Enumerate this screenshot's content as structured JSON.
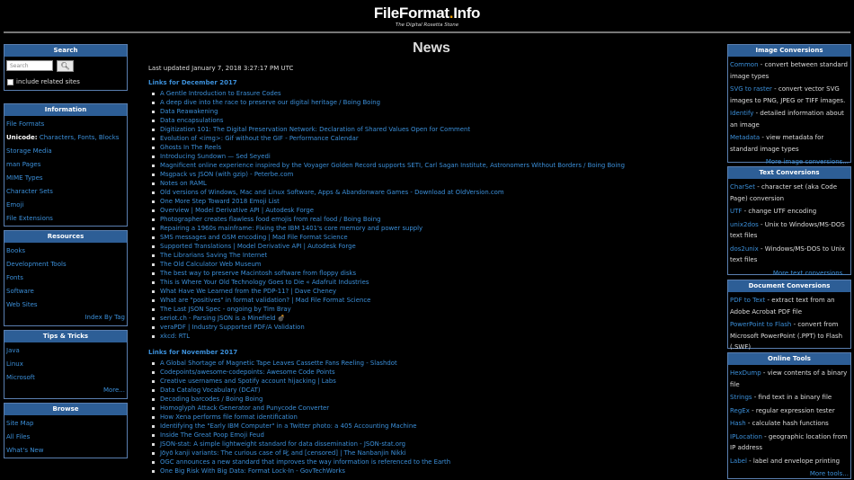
{
  "site": {
    "title_main": "FileFormat",
    "title_dot": ".",
    "title_tld": "Info",
    "tagline": "The Digital Rosetta Stone"
  },
  "search": {
    "title": "Search",
    "placeholder": "Search",
    "include_label": "include related sites"
  },
  "information": {
    "title": "Information",
    "items": [
      "File Formats"
    ],
    "unicode_label": "Unicode:",
    "unicode_links": [
      "Characters",
      "Fonts",
      "Blocks"
    ],
    "items2": [
      "Storage Media",
      "man Pages",
      "MIME Types",
      "Character Sets",
      "Emoji",
      "File Extensions"
    ]
  },
  "resources": {
    "title": "Resources",
    "items": [
      "Books",
      "Development Tools",
      "Fonts",
      "Software",
      "Web Sites"
    ],
    "more": "Index By Tag"
  },
  "tips": {
    "title": "Tips & Tricks",
    "items": [
      "Java",
      "Linux",
      "Microsoft"
    ],
    "more": "More..."
  },
  "browse": {
    "title": "Browse",
    "items": [
      "Site Map",
      "All Files",
      "What's New"
    ]
  },
  "main": {
    "heading": "News",
    "updated": "Last updated January 7, 2018 3:27:17 PM UTC",
    "sections": [
      {
        "title": "Links for December 2017",
        "links": [
          "A Gentle Introduction to Erasure Codes",
          "A deep dive into the race to preserve our digital heritage / Boing Boing",
          "Data Reawakening",
          "Data encapsulations",
          "Digitization 101: The Digital Preservation Network: Declaration of Shared Values Open for Comment",
          "Evolution of <img>: Gif without the GIF - Performance Calendar",
          "Ghosts In The Reels",
          "Introducing Sundown — Sed Seyedi",
          "Magnificent online experience inspired by the Voyager Golden Record supports SETI, Carl Sagan Institute, Astronomers Without Borders / Boing Boing",
          "Msgpack vs JSON (with gzip) - Peterbe.com",
          "Notes on RAML",
          "Old versions of Windows, Mac and Linux Software, Apps & Abandonware Games - Download at OldVersion.com",
          "One More Step Toward 2018 Emoji List",
          "Overview | Model Derivative API | Autodesk Forge",
          "Photographer creates flawless food emojis from real food / Boing Boing",
          "Repairing a 1960s mainframe: Fixing the IBM 1401's core memory and power supply",
          "SMS messages and GSM encoding | Mad File Format Science",
          "Supported Translations | Model Derivative API | Autodesk Forge",
          "The Librarians Saving The Internet",
          "The Old Calculator Web Museum",
          "The best way to preserve Macintosh software from floppy disks",
          "This is Where Your Old Technology Goes to Die « Adafruit Industries",
          "What Have We Learned from the PDP-11? | Dave Cheney",
          "What are \"positives\" in format validation? | Mad File Format Science",
          "The Last JSON Spec - ongoing by Tim Bray",
          "seriot.ch - Parsing JSON is a Minefield 💣",
          "veraPDF | Industry Supported PDF/A Validation",
          "xkcd: RTL"
        ]
      },
      {
        "title": "Links for November 2017",
        "links": [
          "A Global Shortage of Magnetic Tape Leaves Cassette Fans Reeling - Slashdot",
          "Codepoints/awesome-codepoints: Awesome Code Points",
          "Creative usernames and Spotify account hijacking | Labs",
          "Data Catalog Vocabulary (DCAT)",
          "Decoding barcodes / Boing Boing",
          "Homoglyph Attack Generator and Punycode Converter",
          "How Xena performs file format identification",
          "Identifying the \"Early IBM Computer\" in a Twitter photo: a 405 Accounting Machine",
          "Inside The Great Poop Emoji Feud",
          "JSON-stat: A simple lightweight standard for data dissemination - JSON-stat.org",
          "Jōyō kanji variants: The curious case of 叱 and [censored] | The Nanbanjin Nikki",
          "OGC announces a new standard that improves the way information is referenced to the Earth",
          "One Big Risk With Big Data: Format Lock-In - GovTechWorks"
        ]
      }
    ]
  },
  "image_conversions": {
    "title": "Image Conversions",
    "entries": [
      {
        "link": "Common",
        "desc": " - convert between standard image types"
      },
      {
        "link": "SVG to raster",
        "desc": " - convert vector SVG images to PNG, JPEG or TIFF images."
      },
      {
        "link": "Identify",
        "desc": " - detailed information about an image"
      },
      {
        "link": "Metadata",
        "desc": " - view metadata for standard image types"
      }
    ],
    "more": "More image conversions..."
  },
  "text_conversions": {
    "title": "Text Conversions",
    "entries": [
      {
        "link": "CharSet",
        "desc": " - character set (aka Code Page) conversion"
      },
      {
        "link": "UTF",
        "desc": " - change UTF encoding"
      },
      {
        "link": "unix2dos",
        "desc": " - Unix to Windows/MS-DOS text files"
      },
      {
        "link": "dos2unix",
        "desc": " - Windows/MS-DOS to Unix text files"
      }
    ],
    "more": "More text conversions..."
  },
  "document_conversions": {
    "title": "Document Conversions",
    "entries": [
      {
        "link": "PDF to Text",
        "desc": " - extract text from an Adobe Acrobat PDF file"
      },
      {
        "link": "PowerPoint to Flash",
        "desc": " - convert from Microsoft PowerPoint (.PPT) to Flash (.SWF)"
      }
    ]
  },
  "online_tools": {
    "title": "Online Tools",
    "entries": [
      {
        "link": "HexDump",
        "desc": " - view contents of a binary file"
      },
      {
        "link": "Strings",
        "desc": " - find text in a binary file"
      },
      {
        "link": "RegEx",
        "desc": " - regular expression tester"
      },
      {
        "link": "Hash",
        "desc": " - calculate hash functions"
      },
      {
        "link": "IPLocation",
        "desc": " - geographic location from IP address"
      },
      {
        "link": "Label",
        "desc": " - label and envelope printing"
      }
    ],
    "more": "More tools..."
  },
  "colors": {
    "accent": "#3b8fd9",
    "box_header": "#2d5e96",
    "logo_dot": "#f2a100"
  }
}
